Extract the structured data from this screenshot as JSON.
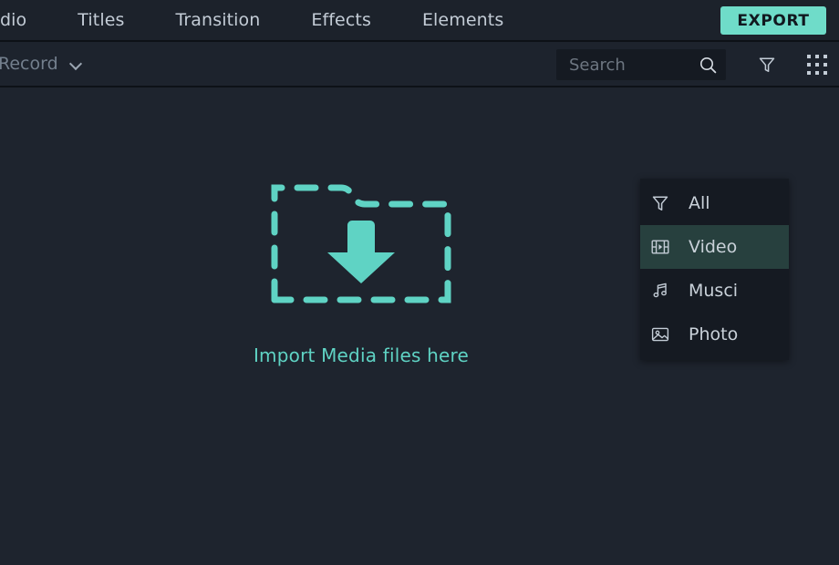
{
  "app": {
    "accent_color": "#6fdcc9",
    "background_color": "#1e242e",
    "panel_color": "#151a22",
    "selected_row_color": "#27403e"
  },
  "top_bar": {
    "tabs": [
      {
        "label": "dio",
        "icon": "text-tab",
        "truncated": true
      },
      {
        "label": "Titles",
        "icon": "text-tab"
      },
      {
        "label": "Transition",
        "icon": "text-tab"
      },
      {
        "label": "Effects",
        "icon": "text-tab"
      },
      {
        "label": "Elements",
        "icon": "text-tab"
      }
    ],
    "export_button": {
      "label": "EXPORT",
      "icon": "export-button",
      "color": "#6fdcc9"
    }
  },
  "toolbar": {
    "record_dropdown": {
      "label": "Record",
      "chevron_icon": "chevron-down-icon"
    },
    "search": {
      "placeholder": "Search",
      "value": "",
      "icon": "search-icon"
    },
    "filter_button": {
      "icon": "filter-funnel-icon"
    },
    "grid_button": {
      "icon": "grid-view-icon"
    }
  },
  "filter_menu": {
    "visible": true,
    "items": [
      {
        "label": "All",
        "icon": "filter-funnel-icon",
        "selected": false
      },
      {
        "label": "Video",
        "icon": "film-strip-icon",
        "selected": true
      },
      {
        "label": "Musci",
        "icon": "music-note-icon",
        "selected": false
      },
      {
        "label": "Photo",
        "icon": "photo-image-icon",
        "selected": false
      }
    ]
  },
  "media_panel": {
    "dropzone": {
      "label": "Import Media files here",
      "icon": "folder-download-icon",
      "accent": "#5fd3c4"
    }
  }
}
